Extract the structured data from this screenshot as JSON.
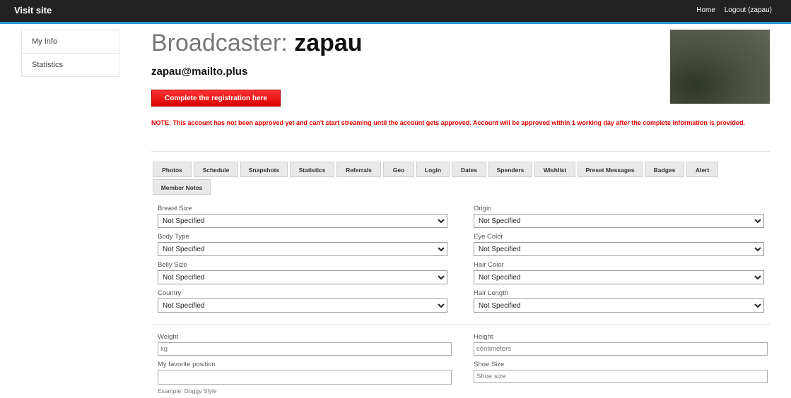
{
  "topbar": {
    "brand": "Visit site",
    "home": "Home",
    "logout": "Logout (zapau)"
  },
  "sidebar": {
    "items": [
      "My Info",
      "Statistics"
    ]
  },
  "header": {
    "title_prefix": "Broadcaster: ",
    "title_name": "zapau",
    "email": "zapau@mailto.plus",
    "register_button": "Complete the registration here",
    "note": "NOTE: This account has not been approved yet and can't start streaming until the account gets approved. Account will be approved within 1 working day after the complete information is provided."
  },
  "tabs": [
    "Photos",
    "Schedule",
    "Snapshots",
    "Statistics",
    "Referrals",
    "Geo",
    "Login",
    "Dates",
    "Spenders",
    "Wishlist",
    "Preset Messages",
    "Badges",
    "Alert",
    "Member Notes"
  ],
  "selects": {
    "breast_size": {
      "label": "Breast Size",
      "value": "Not Specified"
    },
    "body_type": {
      "label": "Body Type",
      "value": "Not Specified"
    },
    "belly_size": {
      "label": "Belly Size",
      "value": "Not Specified"
    },
    "country": {
      "label": "Country",
      "value": "Not Specified"
    },
    "origin": {
      "label": "Origin",
      "value": "Not Specified"
    },
    "eye_color": {
      "label": "Eye Color",
      "value": "Not Specified"
    },
    "hair_color": {
      "label": "Hair Color",
      "value": "Not Specified"
    },
    "hair_length": {
      "label": "Hair Length",
      "value": "Not Specified"
    }
  },
  "inputs": {
    "weight": {
      "label": "Weight",
      "placeholder": "kg"
    },
    "height": {
      "label": "Height",
      "placeholder": "centimeters"
    },
    "favorite_position": {
      "label": "My favorite position",
      "placeholder": "",
      "help": "Example: Doggy Style"
    },
    "shoe_size": {
      "label": "Shoe Size",
      "placeholder": "Shoe size"
    }
  }
}
